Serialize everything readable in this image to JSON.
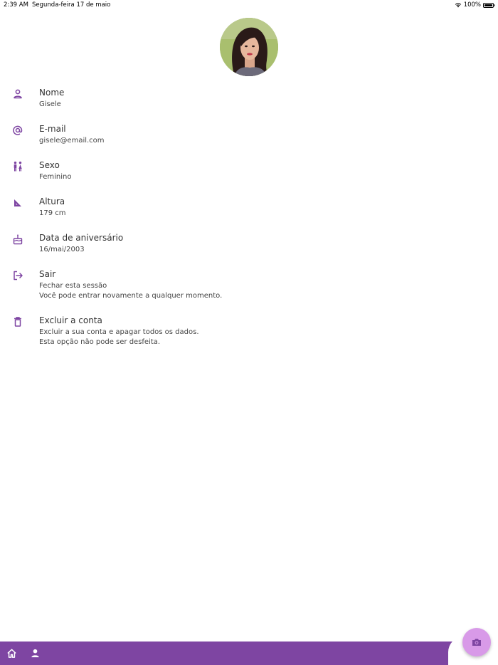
{
  "status_bar": {
    "time": "2:39 AM",
    "date": "Segunda-feira 17 de maio",
    "battery": "100%",
    "icons": [
      "wifi-icon",
      "battery-icon"
    ]
  },
  "profile": {
    "avatar": "profile-photo"
  },
  "items": [
    {
      "icon": "person-icon",
      "title": "Nome",
      "lines": [
        "Gisele"
      ]
    },
    {
      "icon": "at-icon",
      "title": "E-mail",
      "lines": [
        "gisele@email.com"
      ]
    },
    {
      "icon": "gender-icon",
      "title": "Sexo",
      "lines": [
        "Feminino"
      ]
    },
    {
      "icon": "ruler-triangle-icon",
      "title": "Altura",
      "lines": [
        "179 cm"
      ]
    },
    {
      "icon": "cake-icon",
      "title": "Data de aniversário",
      "lines": [
        "16/mai/2003"
      ]
    },
    {
      "icon": "logout-icon",
      "title": "Sair",
      "lines": [
        "Fechar esta sessão",
        "Você pode entrar novamente a qualquer momento."
      ]
    },
    {
      "icon": "trash-icon",
      "title": "Excluir a conta",
      "lines": [
        "Excluir a sua conta e apagar todos os dados.",
        "Esta opção não pode ser desfeita."
      ]
    }
  ],
  "bottom_nav": {
    "items": [
      "home-icon",
      "person-icon"
    ],
    "fab_icon": "camera-icon"
  },
  "colors": {
    "accent": "#7e45a2",
    "fab": "#d89ae8",
    "icon": "#7e45a2"
  }
}
